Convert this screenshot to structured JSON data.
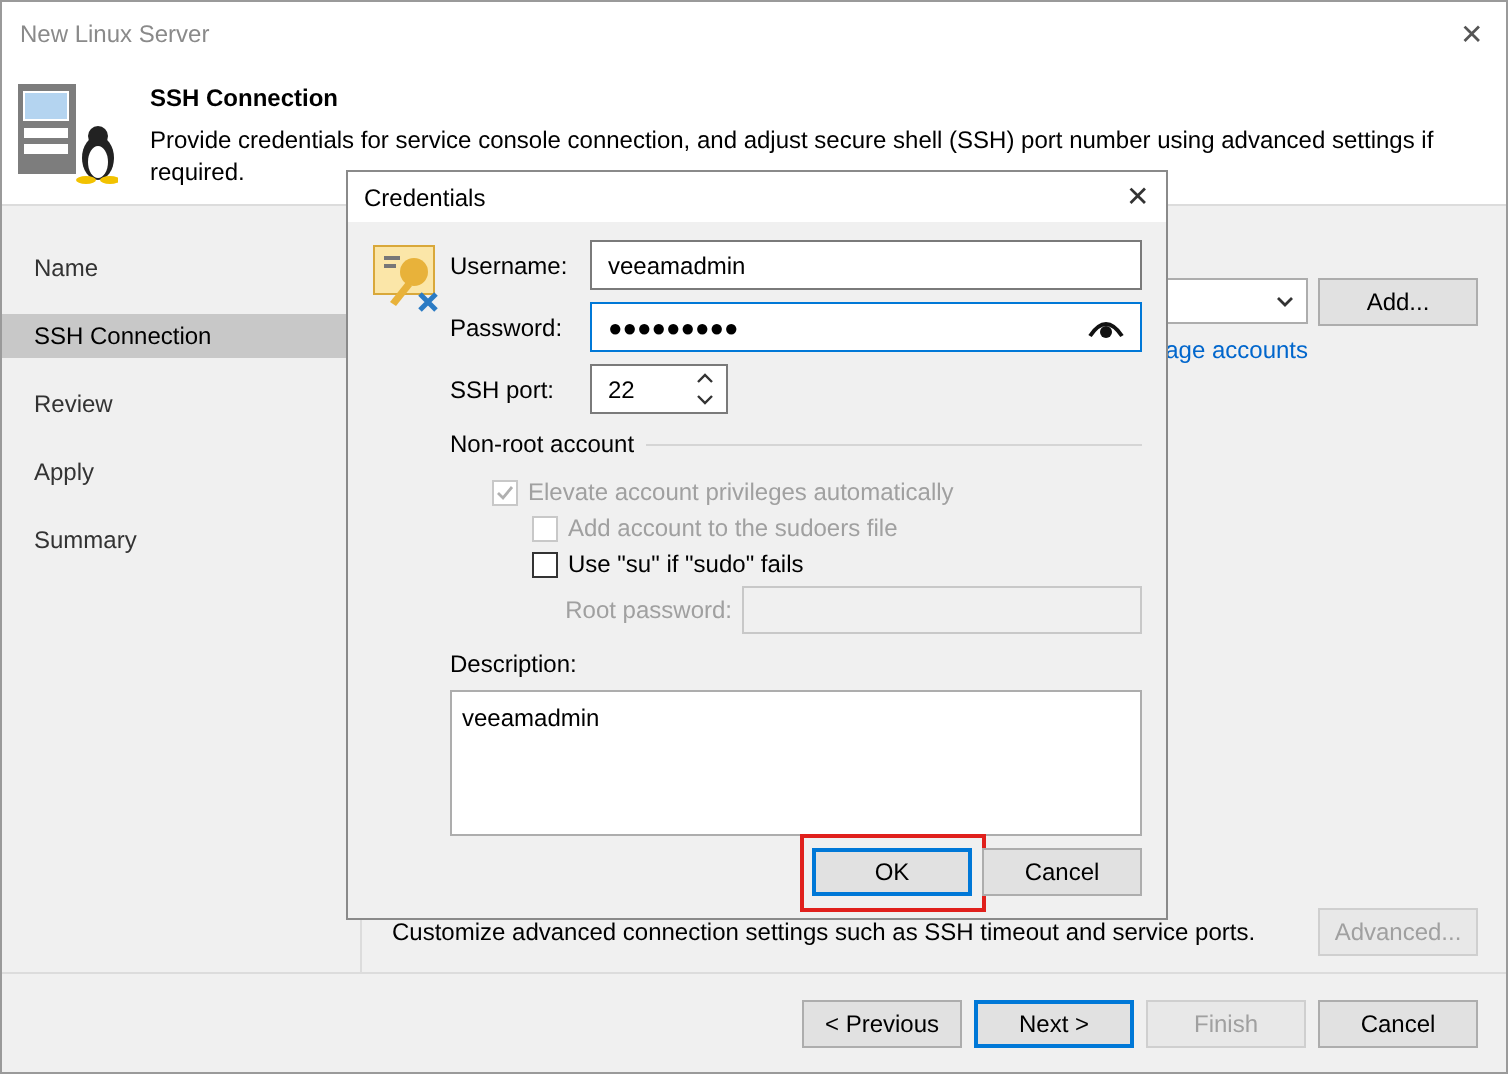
{
  "window": {
    "title": "New Linux Server",
    "close": "✕"
  },
  "header": {
    "title": "SSH Connection",
    "description": "Provide credentials for service console connection, and adjust secure shell (SSH) port number using advanced settings if required."
  },
  "steps": [
    {
      "label": "Name",
      "selected": false
    },
    {
      "label": "SSH Connection",
      "selected": true
    },
    {
      "label": "Review",
      "selected": false
    },
    {
      "label": "Apply",
      "selected": false
    },
    {
      "label": "Summary",
      "selected": false
    }
  ],
  "account": {
    "link": "age accounts",
    "add_button": "Add..."
  },
  "advanced": {
    "description": "Customize advanced connection settings such as SSH timeout and service ports.",
    "button": {
      "label": "Advanced...",
      "disabled": true
    }
  },
  "footer_buttons": [
    {
      "label": "< Previous",
      "disabled": false,
      "focused": false
    },
    {
      "label": "Next >",
      "disabled": false,
      "focused": true
    },
    {
      "label": "Finish",
      "disabled": true,
      "focused": false
    },
    {
      "label": "Cancel",
      "disabled": false,
      "focused": false
    }
  ],
  "dialog": {
    "title": "Credentials",
    "close": "✕",
    "username": {
      "label": "Username:",
      "value": "veeamadmin",
      "focused": false
    },
    "password": {
      "label": "Password:",
      "value": "●●●●●●●●●",
      "focused": true
    },
    "ssh_port": {
      "label": "SSH port:",
      "value": "22"
    },
    "non_root": {
      "title": "Non-root account",
      "options": [
        {
          "label": "Elevate account privileges automatically",
          "checked": true,
          "disabled": true,
          "children": [
            {
              "label": "Add account to the sudoers file",
              "checked": false,
              "disabled": true
            },
            {
              "label": "Use \"su\" if \"sudo\" fails",
              "checked": false,
              "disabled": false
            }
          ]
        }
      ]
    },
    "root_password": {
      "label": "Root password:",
      "disabled": true
    },
    "description": {
      "label": "Description:",
      "value": "veeamadmin"
    },
    "buttons": [
      {
        "label": "OK",
        "focused": true,
        "highlighted": true
      },
      {
        "label": "Cancel",
        "focused": false,
        "highlighted": false
      }
    ]
  }
}
